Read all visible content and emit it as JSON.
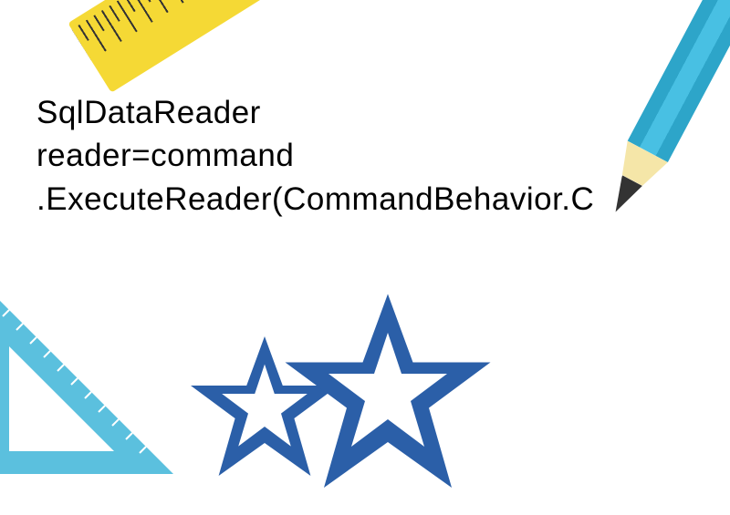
{
  "code": {
    "line1": "SqlDataReader",
    "line2": "reader=command",
    "line3": ".ExecuteReader(CommandBehavior.C"
  }
}
